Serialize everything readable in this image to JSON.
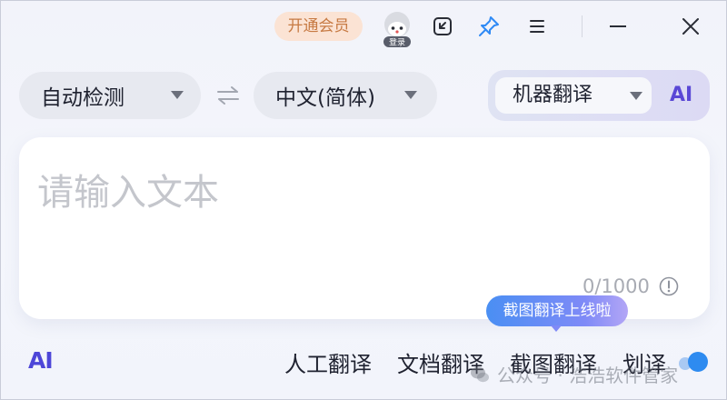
{
  "titlebar": {
    "vip_label": "开通会员",
    "login_badge": "登录",
    "icons": [
      "user-avatar-icon",
      "collapse-window-icon",
      "pin-icon",
      "menu-icon",
      "minimize-icon",
      "close-icon"
    ],
    "pin_color": "#2f8af5"
  },
  "languages": {
    "source": "自动检测",
    "target": "中文(简体)",
    "swap_icon": "swap-arrows-icon"
  },
  "engine": {
    "selected": "机器翻译",
    "ai_tab": "AI"
  },
  "editor": {
    "placeholder": "请输入文本",
    "counter": "0/1000"
  },
  "tooltip": "截图翻译上线啦",
  "bottom": {
    "ai_logo": "AI",
    "tools": [
      "人工翻译",
      "文档翻译",
      "截图翻译",
      "划译"
    ],
    "accent": "#2e8bf0"
  },
  "watermark": "公众号 · 浩浩软件管家"
}
